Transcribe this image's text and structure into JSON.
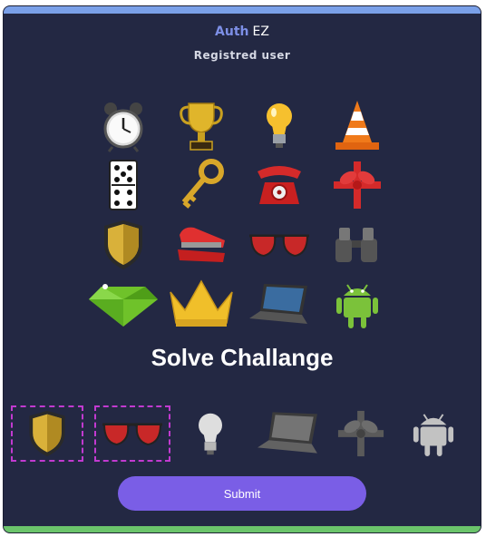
{
  "header": {
    "brand_accent": "Auth",
    "brand_main": "EZ",
    "subtitle": "Registred user"
  },
  "challenge": {
    "icons": [
      [
        "alarm-clock-icon",
        "trophy-icon",
        "lightbulb-icon",
        "traffic-cone-icon"
      ],
      [
        "domino-icon",
        "key-icon",
        "telephone-icon",
        "gift-bow-icon"
      ],
      [
        "shield-icon",
        "stapler-icon",
        "sunglasses-icon",
        "binoculars-icon"
      ],
      [
        "diamond-icon",
        "crown-icon",
        "laptop-icon",
        "android-icon"
      ]
    ],
    "title": "Solve Challange"
  },
  "answers": [
    {
      "icon": "shield-icon",
      "selected": true
    },
    {
      "icon": "sunglasses-icon",
      "selected": true
    },
    {
      "icon": "lightbulb-icon",
      "selected": false
    },
    {
      "icon": "laptop-icon",
      "selected": false
    },
    {
      "icon": "gift-bow-icon",
      "selected": false
    },
    {
      "icon": "android-icon",
      "selected": false
    }
  ],
  "actions": {
    "submit_label": "Submit"
  },
  "colors": {
    "background": "#232843",
    "accent": "#7a5ee6",
    "top_bar": "#7aa0e8",
    "bottom_bar": "#6bc46b",
    "selection": "#c23ad0"
  }
}
